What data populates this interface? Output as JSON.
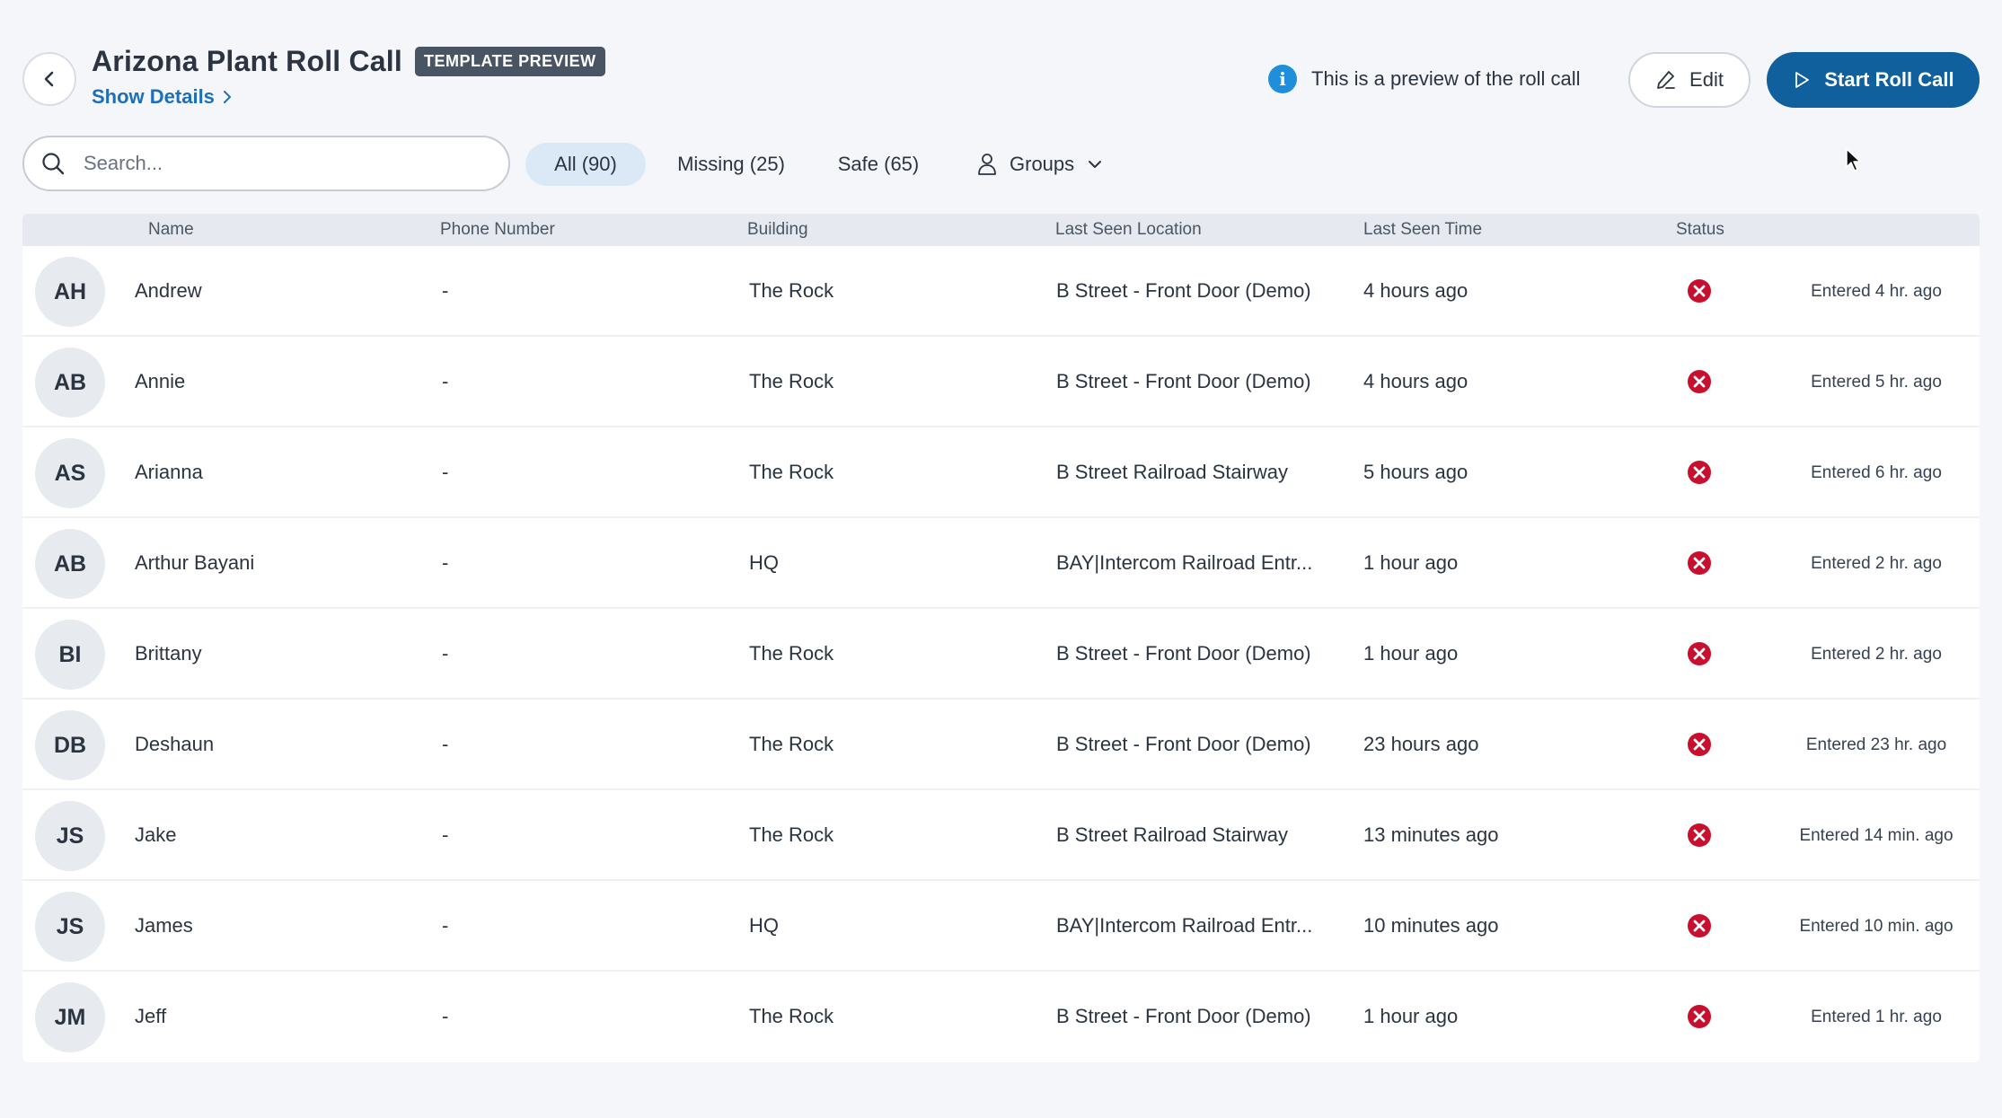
{
  "header": {
    "title": "Arizona Plant Roll Call",
    "badge": "TEMPLATE PREVIEW",
    "show_details": "Show Details",
    "preview_note": "This is a preview of the roll call",
    "edit_label": "Edit",
    "start_label": "Start Roll Call"
  },
  "filters": {
    "search_placeholder": "Search...",
    "all": "All (90)",
    "missing": "Missing (25)",
    "safe": "Safe (65)",
    "groups": "Groups",
    "active": "all"
  },
  "table": {
    "columns": [
      "Name",
      "Phone Number",
      "Building",
      "Last Seen Location",
      "Last Seen Time",
      "Status"
    ],
    "rows": [
      {
        "initials": "AH",
        "name": "Andrew",
        "phone": "-",
        "building": "The Rock",
        "location": "B Street - Front Door (Demo)",
        "time": "4 hours ago",
        "status": "missing",
        "entered": "Entered 4 hr. ago"
      },
      {
        "initials": "AB",
        "name": "Annie",
        "phone": "-",
        "building": "The Rock",
        "location": "B Street - Front Door (Demo)",
        "time": "4 hours ago",
        "status": "missing",
        "entered": "Entered 5 hr. ago"
      },
      {
        "initials": "AS",
        "name": "Arianna",
        "phone": "-",
        "building": "The Rock",
        "location": "B Street Railroad Stairway",
        "time": "5 hours ago",
        "status": "missing",
        "entered": "Entered 6 hr. ago"
      },
      {
        "initials": "AB",
        "name": "Arthur Bayani",
        "phone": "-",
        "building": "HQ",
        "location": "BAY|Intercom Railroad Entr...",
        "time": "1 hour ago",
        "status": "missing",
        "entered": "Entered 2 hr. ago"
      },
      {
        "initials": "BI",
        "name": "Brittany",
        "phone": "-",
        "building": "The Rock",
        "location": "B Street - Front Door (Demo)",
        "time": "1 hour ago",
        "status": "missing",
        "entered": "Entered 2 hr. ago"
      },
      {
        "initials": "DB",
        "name": "Deshaun",
        "phone": "-",
        "building": "The Rock",
        "location": "B Street - Front Door (Demo)",
        "time": "23 hours ago",
        "status": "missing",
        "entered": "Entered 23 hr. ago"
      },
      {
        "initials": "JS",
        "name": "Jake",
        "phone": "-",
        "building": "The Rock",
        "location": "B Street Railroad Stairway",
        "time": "13 minutes ago",
        "status": "missing",
        "entered": "Entered 14 min. ago"
      },
      {
        "initials": "JS",
        "name": "James",
        "phone": "-",
        "building": "HQ",
        "location": "BAY|Intercom Railroad Entr...",
        "time": "10 minutes ago",
        "status": "missing",
        "entered": "Entered 10 min. ago"
      },
      {
        "initials": "JM",
        "name": "Jeff",
        "phone": "-",
        "building": "The Rock",
        "location": "B Street - Front Door (Demo)",
        "time": "1 hour ago",
        "status": "missing",
        "entered": "Entered 1 hr. ago"
      }
    ]
  },
  "colors": {
    "accent": "#11609e",
    "link": "#1d6fb8",
    "status_missing": "#c8102e",
    "active_filter_bg": "#dbe9f6"
  }
}
